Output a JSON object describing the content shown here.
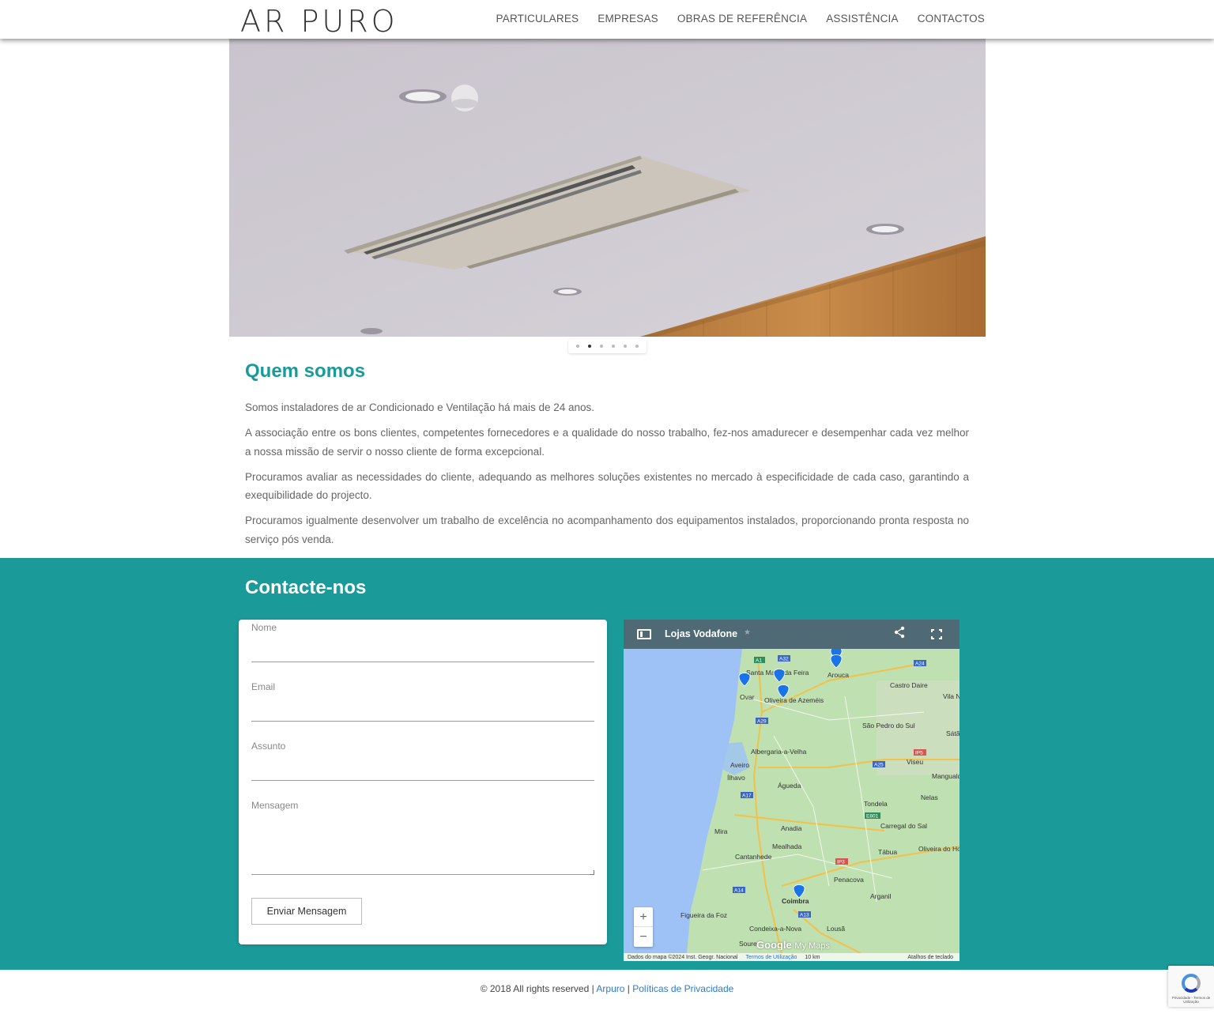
{
  "header": {
    "logo": "AR PURO",
    "nav": [
      "PARTICULARES",
      "EMPRESAS",
      "OBRAS DE REFERÊNCIA",
      "ASSISTÊNCIA",
      "CONTACTOS"
    ]
  },
  "slider": {
    "slide_count": 6,
    "active_index": 1
  },
  "about": {
    "title": "Quem somos",
    "paragraphs": [
      "Somos instaladores de ar Condicionado e Ventilação há mais de 24 anos.",
      "A associação entre os bons clientes, competentes fornecedores e a qualidade do nosso trabalho, fez-nos amadurecer e desempenhar cada vez melhor a nossa missão de servir o nosso cliente de forma excepcional.",
      "Procuramos avaliar as necessidades do cliente, adequando as melhores soluções existentes no mercado à especificidade de cada caso, garantindo a exequibilidade do projecto.",
      "Procuramos igualmente desenvolver um trabalho de excelência no acompanhamento dos equipamentos instalados, proporcionando pronta resposta no serviço pós venda."
    ]
  },
  "contact": {
    "title": "Contacte-nos",
    "form": {
      "name_label": "Nome",
      "email_label": "Email",
      "subject_label": "Assunto",
      "message_label": "Mensagem",
      "submit_label": "Enviar Mensagem"
    },
    "map": {
      "title": "Lojas Vodafone",
      "zoom_in": "+",
      "zoom_out": "−",
      "attribution": "Dados do mapa ©2024 Inst. Geogr. Nacional",
      "terms": "Termos de Utilização",
      "scale": "10 km",
      "shortcuts": "Atalhos de teclado",
      "brand": "Google",
      "brand_sub": "My Maps",
      "places": [
        "Santa Maria da Feira",
        "Arouca",
        "Ovar",
        "Oliveira de Azeméis",
        "Castro Daire",
        "Vila Nova de Paiva",
        "São Pedro do Sul",
        "Albergaria-a-Velha",
        "Viseu",
        "Aveiro",
        "Ílhavo",
        "Águeda",
        "Mangualde",
        "Nelas",
        "Tondela",
        "Anadia",
        "Mira",
        "Carregal do Sal",
        "Mealhada",
        "Cantanhede",
        "Tábua",
        "Oliveira do Hospital",
        "Penacova",
        "Arganil",
        "Coimbra",
        "Figueira da Foz",
        "Condeixa-a-Nova",
        "Lousã",
        "Soure",
        "Sátão"
      ],
      "roads": [
        "A1",
        "A32",
        "A24",
        "A29",
        "IP5",
        "A25",
        "A17",
        "E801",
        "IP3",
        "A14",
        "A13"
      ]
    }
  },
  "footer": {
    "copyright": "© 2018 All rights reserved |",
    "link1": "Arpuro",
    "separator": "|",
    "link2": "Políticas de Privacidade"
  },
  "recaptcha": {
    "text": "Privacidade - Termos de Utilização"
  },
  "colors": {
    "teal": "#1b9a9a",
    "link": "#2b7bd4",
    "map_bar": "#4f6a75",
    "marker": "#1a73e8"
  }
}
